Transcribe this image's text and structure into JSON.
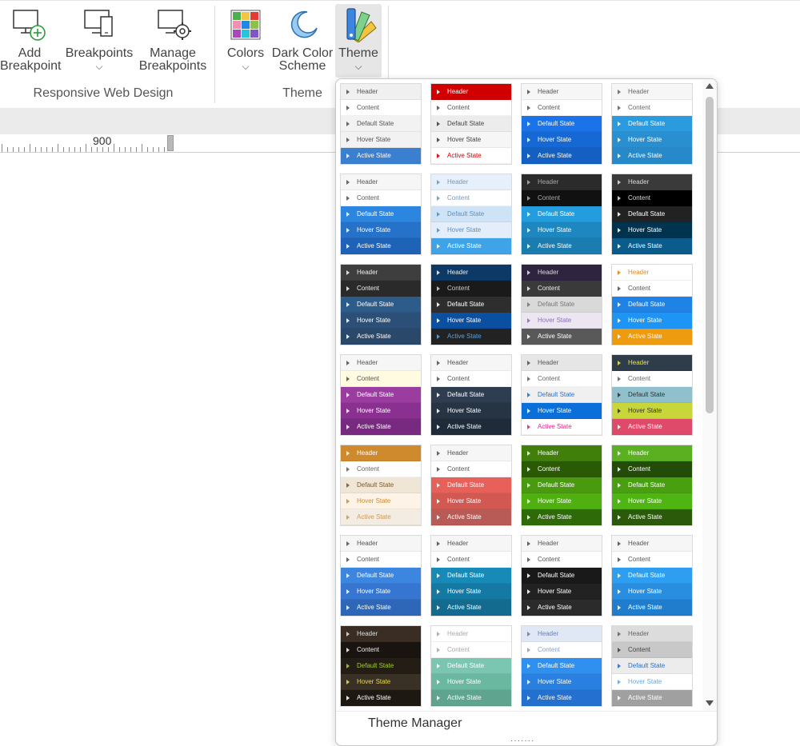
{
  "ribbon": {
    "add_breakpoint": {
      "line1": "Add",
      "line2": "Breakpoint"
    },
    "breakpoints": {
      "label": "Breakpoints",
      "chevron": "⌵"
    },
    "manage_breakpoints": {
      "line1": "Manage",
      "line2": "Breakpoints"
    },
    "colors": {
      "label": "Colors",
      "chevron": "⌵"
    },
    "dark_color_scheme": {
      "line1": "Dark Color",
      "line2": "Scheme"
    },
    "theme": {
      "label": "Theme",
      "chevron": "⌵"
    },
    "group_responsive": "Responsive Web Design",
    "group_theme": "Theme"
  },
  "ruler": {
    "label": "900"
  },
  "dropdown": {
    "theme_manager_label": "Theme Manager",
    "grip": "·······",
    "row_labels": [
      "Header",
      "Content",
      "Default State",
      "Hover State",
      "Active State"
    ],
    "themes": [
      {
        "rows": [
          [
            "#f0f0f0",
            "#555"
          ],
          [
            "#ffffff",
            "#555"
          ],
          [
            "#f2f2f2",
            "#555"
          ],
          [
            "#f2f2f2",
            "#555"
          ],
          [
            "#3b7fd0",
            "#fff"
          ]
        ]
      },
      {
        "rows": [
          [
            "#d10000",
            "#fff"
          ],
          [
            "#ffffff",
            "#555"
          ],
          [
            "#ececec",
            "#444"
          ],
          [
            "#f6f6f6",
            "#444"
          ],
          [
            "#ffffff",
            "#d10000"
          ]
        ]
      },
      {
        "rows": [
          [
            "#f6f6f6",
            "#555"
          ],
          [
            "#ffffff",
            "#555"
          ],
          [
            "#1a73e8",
            "#fff"
          ],
          [
            "#1668d4",
            "#fff"
          ],
          [
            "#135fc2",
            "#fff"
          ]
        ]
      },
      {
        "rows": [
          [
            "#f6f6f6",
            "#666"
          ],
          [
            "#ffffff",
            "#666"
          ],
          [
            "#2b9be0",
            "#fff"
          ],
          [
            "#2a8fd0",
            "#fff"
          ],
          [
            "#2689c9",
            "#fff"
          ]
        ]
      },
      {
        "rows": [
          [
            "#f6f6f6",
            "#555"
          ],
          [
            "#ffffff",
            "#555"
          ],
          [
            "#2c86e0",
            "#fff"
          ],
          [
            "#2672c8",
            "#fff"
          ],
          [
            "#1f63b8",
            "#fff"
          ]
        ]
      },
      {
        "rows": [
          [
            "#e6f0fa",
            "#7a97b5"
          ],
          [
            "#ffffff",
            "#7a97b5"
          ],
          [
            "#cfe3f7",
            "#5b8ec4"
          ],
          [
            "#e3eefa",
            "#5b8ec4"
          ],
          [
            "#3fa3e8",
            "#fff"
          ]
        ]
      },
      {
        "rows": [
          [
            "#2b2b2b",
            "#aaa"
          ],
          [
            "#111111",
            "#aaa"
          ],
          [
            "#239ddd",
            "#fff"
          ],
          [
            "#1e87c0",
            "#fff"
          ],
          [
            "#1b7cb0",
            "#fff"
          ]
        ]
      },
      {
        "rows": [
          [
            "#3a3a3a",
            "#ddd"
          ],
          [
            "#000000",
            "#ddd"
          ],
          [
            "#222222",
            "#fff"
          ],
          [
            "#00334d",
            "#fff"
          ],
          [
            "#0a5c8c",
            "#fff"
          ]
        ]
      },
      {
        "rows": [
          [
            "#3e3e3e",
            "#eee"
          ],
          [
            "#2a2a2a",
            "#eee"
          ],
          [
            "#2d5b8a",
            "#fff"
          ],
          [
            "#2b4f76",
            "#fff"
          ],
          [
            "#29486a",
            "#fff"
          ]
        ]
      },
      {
        "rows": [
          [
            "#0c3966",
            "#eee"
          ],
          [
            "#1a1a1a",
            "#ccc"
          ],
          [
            "#2e2e2e",
            "#fff"
          ],
          [
            "#0b4fa0",
            "#fff"
          ],
          [
            "#222222",
            "#5aa0e0"
          ]
        ]
      },
      {
        "rows": [
          [
            "#2e2440",
            "#ddd"
          ],
          [
            "#3a3a3a",
            "#eee"
          ],
          [
            "#d9d9d9",
            "#777"
          ],
          [
            "#ece6f0",
            "#8d6fb8"
          ],
          [
            "#595959",
            "#fff"
          ]
        ]
      },
      {
        "rows": [
          [
            "#ffffff",
            "#e08a1e"
          ],
          [
            "#ffffff",
            "#555"
          ],
          [
            "#1e82e6",
            "#fff"
          ],
          [
            "#1e94f5",
            "#fff"
          ],
          [
            "#ef9b0f",
            "#fff"
          ]
        ]
      },
      {
        "rows": [
          [
            "#f6f6f6",
            "#555"
          ],
          [
            "#fffbe0",
            "#555"
          ],
          [
            "#9b3da0",
            "#fff"
          ],
          [
            "#8a3090",
            "#fff"
          ],
          [
            "#772a80",
            "#fff"
          ]
        ]
      },
      {
        "rows": [
          [
            "#f6f6f6",
            "#555"
          ],
          [
            "#ffffff",
            "#555"
          ],
          [
            "#2e3e50",
            "#fff"
          ],
          [
            "#263444",
            "#fff"
          ],
          [
            "#1f2b38",
            "#fff"
          ]
        ]
      },
      {
        "rows": [
          [
            "#e6e6e6",
            "#555"
          ],
          [
            "#ffffff",
            "#666"
          ],
          [
            "#f0f0f0",
            "#2a6fd0"
          ],
          [
            "#0a6fd8",
            "#fff"
          ],
          [
            "#ffffff",
            "#e0258a"
          ]
        ]
      },
      {
        "rows": [
          [
            "#2f3d4a",
            "#e8e24a"
          ],
          [
            "#ffffff",
            "#666"
          ],
          [
            "#8fc0cc",
            "#333"
          ],
          [
            "#c9d63a",
            "#333"
          ],
          [
            "#e04a6a",
            "#fff"
          ]
        ]
      },
      {
        "rows": [
          [
            "#d08a2e",
            "#fff"
          ],
          [
            "#ffffff",
            "#666"
          ],
          [
            "#efe6d6",
            "#7a5a30"
          ],
          [
            "#fdf3e6",
            "#d08a2e"
          ],
          [
            "#f3ece2",
            "#c89a5a"
          ]
        ]
      },
      {
        "rows": [
          [
            "#f6f6f6",
            "#555"
          ],
          [
            "#ffffff",
            "#555"
          ],
          [
            "#e8605a",
            "#fff"
          ],
          [
            "#d25852",
            "#fff"
          ],
          [
            "#b85a55",
            "#fff"
          ]
        ]
      },
      {
        "rows": [
          [
            "#3f7f0a",
            "#fff"
          ],
          [
            "#2b5a05",
            "#fff"
          ],
          [
            "#4a9a10",
            "#fff"
          ],
          [
            "#4fb00f",
            "#fff"
          ],
          [
            "#2f6a08",
            "#fff"
          ]
        ]
      },
      {
        "rows": [
          [
            "#5ab020",
            "#fff"
          ],
          [
            "#234c08",
            "#fff"
          ],
          [
            "#48a010",
            "#fff"
          ],
          [
            "#4fb512",
            "#fff"
          ],
          [
            "#2a5a0a",
            "#fff"
          ]
        ]
      },
      {
        "rows": [
          [
            "#f6f6f6",
            "#555"
          ],
          [
            "#ffffff",
            "#555"
          ],
          [
            "#3d86e0",
            "#fff"
          ],
          [
            "#3676d0",
            "#fff"
          ],
          [
            "#2e66b8",
            "#fff"
          ]
        ]
      },
      {
        "rows": [
          [
            "#f6f6f6",
            "#555"
          ],
          [
            "#ffffff",
            "#555"
          ],
          [
            "#188ab8",
            "#fff"
          ],
          [
            "#157aa3",
            "#fff"
          ],
          [
            "#136b8f",
            "#fff"
          ]
        ]
      },
      {
        "rows": [
          [
            "#f6f6f6",
            "#555"
          ],
          [
            "#ffffff",
            "#555"
          ],
          [
            "#191919",
            "#fff"
          ],
          [
            "#222222",
            "#fff"
          ],
          [
            "#2b2b2b",
            "#fff"
          ]
        ]
      },
      {
        "rows": [
          [
            "#f6f6f6",
            "#555"
          ],
          [
            "#ffffff",
            "#555"
          ],
          [
            "#2d9ef0",
            "#fff"
          ],
          [
            "#2a8ee0",
            "#fff"
          ],
          [
            "#207ccc",
            "#fff"
          ]
        ]
      },
      {
        "rows": [
          [
            "#3a2e24",
            "#ddd"
          ],
          [
            "#1a1410",
            "#eee"
          ],
          [
            "#241d16",
            "#9fd12a"
          ],
          [
            "#3a3126",
            "#e8d84a"
          ],
          [
            "#1e1812",
            "#fff"
          ]
        ]
      },
      {
        "rows": [
          [
            "#ffffff",
            "#aaa"
          ],
          [
            "#ffffff",
            "#aaa"
          ],
          [
            "#7ac6b0",
            "#fff"
          ],
          [
            "#6ab89f",
            "#fff"
          ],
          [
            "#5ea48e",
            "#fff"
          ]
        ]
      },
      {
        "rows": [
          [
            "#e0e8f5",
            "#6a7fb0"
          ],
          [
            "#ffffff",
            "#8aa0c8"
          ],
          [
            "#3090f0",
            "#fff"
          ],
          [
            "#2a80e0",
            "#fff"
          ],
          [
            "#2370d0",
            "#fff"
          ]
        ]
      },
      {
        "rows": [
          [
            "#dcdcdc",
            "#666"
          ],
          [
            "#c8c8c8",
            "#444"
          ],
          [
            "#ececec",
            "#2a6fc8"
          ],
          [
            "#ffffff",
            "#6aa6e0"
          ],
          [
            "#a0a0a0",
            "#fff"
          ]
        ]
      }
    ]
  }
}
